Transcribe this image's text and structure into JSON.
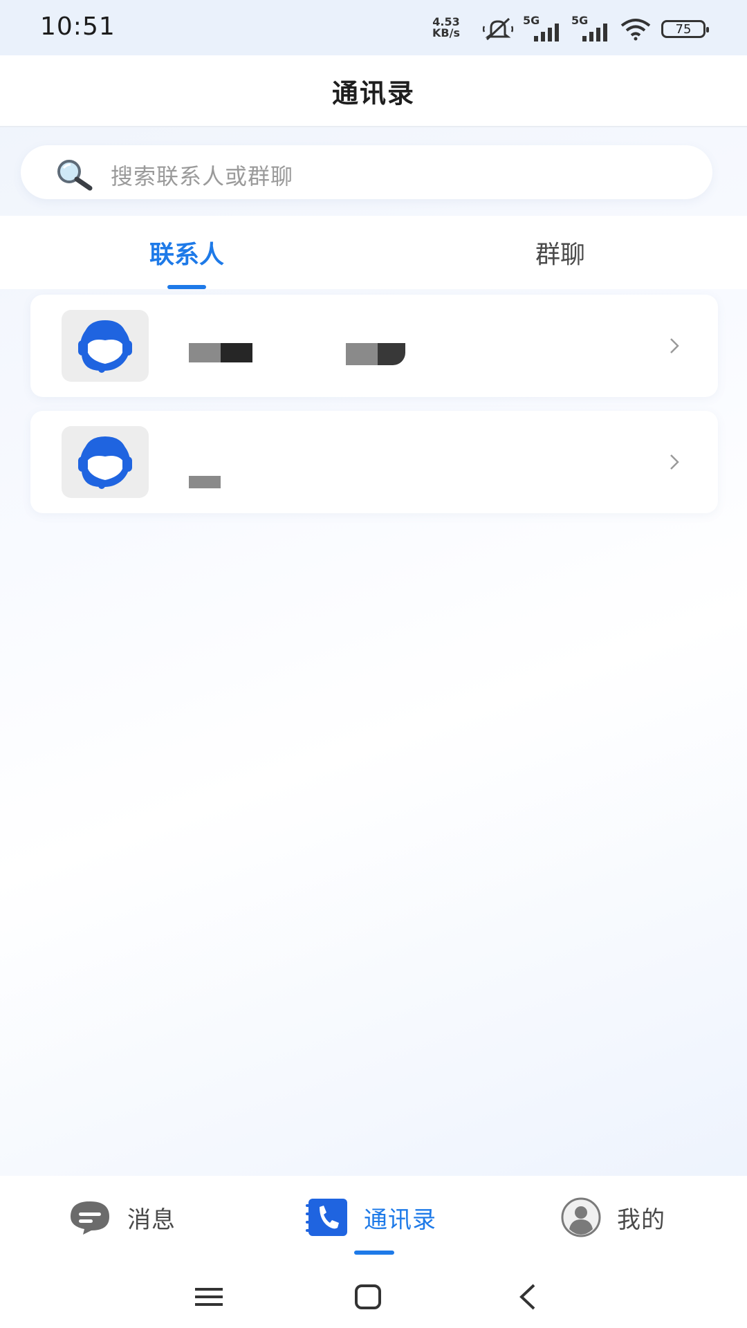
{
  "status_bar": {
    "time": "10:51",
    "net_speed_value": "4.53",
    "net_speed_unit": "KB/s",
    "signal_1_label": "5G",
    "signal_2_label": "5G",
    "battery": "75"
  },
  "header": {
    "title": "通讯录"
  },
  "search": {
    "placeholder": "搜索联系人或群聊"
  },
  "tabs": [
    {
      "label": "联系人",
      "active": true
    },
    {
      "label": "群聊",
      "active": false
    }
  ],
  "contacts": [
    {
      "avatar_icon": "headset-support-icon"
    },
    {
      "avatar_icon": "headset-support-icon"
    }
  ],
  "bottom_nav": [
    {
      "label": "消息",
      "icon": "message-icon",
      "active": false
    },
    {
      "label": "通讯录",
      "icon": "phone-book-icon",
      "active": true
    },
    {
      "label": "我的",
      "icon": "profile-icon",
      "active": false
    }
  ],
  "colors": {
    "accent": "#1e7ae8",
    "avatar_blue": "#1f64e0",
    "inactive": "#4a4a4a"
  }
}
